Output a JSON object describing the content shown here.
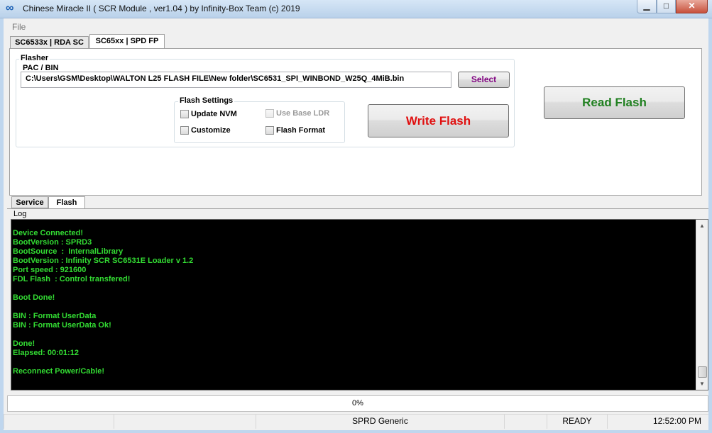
{
  "window": {
    "title": "Chinese Miracle II ( SCR Module , ver1.04  ) by Infinity-Box Team (c) 2019",
    "icon": "infinity-icon",
    "minimize_glyph": "▁",
    "maximize_glyph": "□",
    "close_glyph": "✕"
  },
  "menu": {
    "file": "File"
  },
  "tabs_top": [
    {
      "label": "SC6533x | RDA SC",
      "active": false
    },
    {
      "label": "SC65xx | SPD FP",
      "active": true
    }
  ],
  "flasher": {
    "group_title": "Flasher",
    "pac_bin_label": "PAC / BIN",
    "file_path": "C:\\Users\\GSM\\Desktop\\WALTON L25 FLASH FILE\\New folder\\SC6531_SPI_WINBOND_W25Q_4MiB.bin",
    "select_label": "Select",
    "settings_title": "Flash Settings",
    "options": [
      {
        "label": "Update NVM",
        "checked": false,
        "enabled": true
      },
      {
        "label": "Use Base LDR",
        "checked": false,
        "enabled": false
      },
      {
        "label": "Customize",
        "checked": false,
        "enabled": true
      },
      {
        "label": "Flash Format",
        "checked": false,
        "enabled": true
      }
    ],
    "write_label": "Write Flash",
    "read_label": "Read Flash"
  },
  "tabs_bottom": [
    {
      "label": "Service",
      "active": false
    },
    {
      "label": "Flash",
      "active": true
    }
  ],
  "log": {
    "label": "Log",
    "lines": [
      "Device Connected!",
      "BootVersion : SPRD3",
      "BootSource  :  InternalLibrary",
      "BootVersion : Infinity SCR SC6531E Loader v 1.2",
      "Port speed : 921600",
      "FDL Flash  : Control transfered!",
      "",
      "Boot Done!",
      "",
      "BIN : Format UserData",
      "BIN : Format UserData Ok!",
      "",
      "Done!",
      "Elapsed: 00:01:12",
      "",
      "Reconnect Power/Cable!"
    ],
    "text_color": "#33dd33",
    "background": "#000000"
  },
  "progress": {
    "text": "0%",
    "value": 0
  },
  "status": {
    "cell1": "",
    "cell2": "",
    "cell3": "SPRD Generic",
    "cell4": "",
    "cell5": "READY",
    "cell6": "12:52:00 PM"
  }
}
